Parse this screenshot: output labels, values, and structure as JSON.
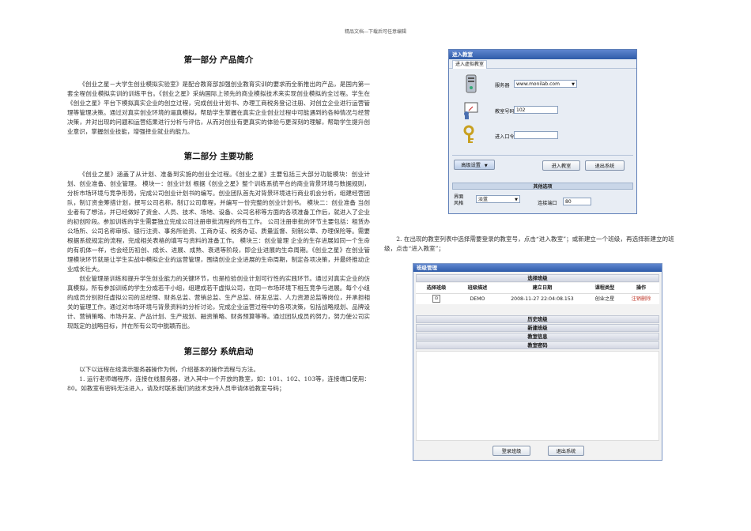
{
  "header": "精品文档---下载后可任意编辑",
  "sections": [
    {
      "title": "第一部分  产品简介",
      "paragraphs": [
        "《创业之星－大学生创业模拟实验室》是配合教育部加强创业教育实训的要求而全新推出的产品，是国内第一套全程创业模拟实训的训练平台。《创业之星》采纳国际上领先的商业模拟技术来实现创业模拟的全过程。学生在《创业之星》平台下模拟真实企业的创立过程，完成创业计划书、办理工商税务登记注册、对创立企业进行运营管理等管理决策。通过对真实创业环境的逼真模拟，帮助学生掌握在真实企业创业过程中可能遇到的各种情况与经营决策，并对出现的问题和运营结果进行分析与评估，从而对创业有更真实的体验与更深刻的理解，帮助学生提升创业意识，掌握创业技能，增强择业就业的能力。"
      ]
    },
    {
      "title": "第二部分  主要功能",
      "paragraphs": [
        "《创业之星》涵盖了从计划、准备到实施的创业全过程。《创业之星》主要包括三大部分功能模块：创业计划、创业准备、创业管理。  模块一：创业计划 根据《创业之星》整个训练系统平台的商业背景环境与数据规则，分析市场环境与竞争形势，完成公司创业计划书的编写。创业团队首先对背景环境进行商业机会分析，组建经营团队，制订资金筹措计划，撰写公司名称，制订公司章程，并编写一份完整的创业计划书。  模块二：创业准备 当创业者有了想法，并已经做好了资金、人员、技术、场地、设备、公司名称等方面的各项准备工作后，就进入了企业的初创阶段。参加训练的学生需要独立完成公司注册审批流程的所有工作。  公司注册审批的环节主要包括：租赁办公场所、公司名称审核、银行注资、事务所验资、工商办证、税务办证、质量监督、刻制公章、办理保险等。需要根据系统规定的流程，完成相关表格的填写与资料的准备工作。  模块三：创业管理  企业的生存进展如同一个生命的有机体一样，也会经历初创、成长、进展、成熟、衰退等阶段，即企业进展的生命周期。《创业之星》在创业管理模块环节就是让学生实战中模拟企业的运营管理，围绕创业企业进展的生命周期，制定各项决策，并最终推动企业成长壮大。",
        "创业管理是训练和提升学生创业能力的关键环节，也是检验创业计划可行性的实践环节。通过对真实企业的仿真模拟，所有参加训练的学生分成若干小组，组建成若干虚拟公司，在同一市场环境下相互竞争与进展。每个小组的成员分别担任虚拟公司的总经理、财务总监、营销总监、生产总监、研发总监、人力资源总监等岗位，并承担相关的管理工作。通过对市场环境与背景资料的分析讨论，完成企业运营过程中的各项决策，包括战略规划、品牌设计、营销策略、市场开发、产品计划、生产规划、融资策略、财务预算等等。通过团队成员的努力，努力使公司实现既定的战略目标，并在所有公司中脱颖而出。"
      ]
    },
    {
      "title": "第三部分  系统启动",
      "paragraphs": [
        "以下以远程在线演示服务器操作为例，介绍基本的操作流程与方法。",
        "1. 运行老师端程序，连接在线服务器，进入其中一个开放的教室，如：101、102、103等，连接端口使用：80。如教室有密码无法进入，请及时联系我们的技术支持人员申请体验教室号码；"
      ]
    }
  ],
  "right_text": "2. 在出现的教室列表中选择需要登录的教室号，点击“进入教室”；或新建立一个班级，再选择新建立的班级，点击“进入教室”；",
  "dialog1": {
    "title": "进入教室",
    "tab": "进入虚拟教室",
    "server_label": "服务器",
    "server_value": "www.monilab.com",
    "room_label": "教室号码",
    "room_value": "102",
    "password_label": "进入口令",
    "password_value": "",
    "advanced_button": "高级设置",
    "enter_button": "进入教室",
    "exit_button": "退出系统",
    "options_header": "其他选项",
    "style_label": "界面风格",
    "style_value": "淡蓝",
    "port_label": "连接端口",
    "port_value": "80"
  },
  "dialog2": {
    "title": "班级管理",
    "select_header": "选择班级",
    "columns": [
      "选择班级",
      "班级描述",
      "建立日期",
      "课程类型",
      "操作"
    ],
    "rows": [
      {
        "select": "⊙",
        "desc": "DEMO",
        "date": "2008-11-27 22:04:08.153",
        "type": "创业之星",
        "op": "注销删除"
      }
    ],
    "sections": [
      "历史班级",
      "新建班级",
      "教室信息",
      "教室密码"
    ],
    "login_button": "登录班级",
    "exit_button": "退出系统"
  }
}
